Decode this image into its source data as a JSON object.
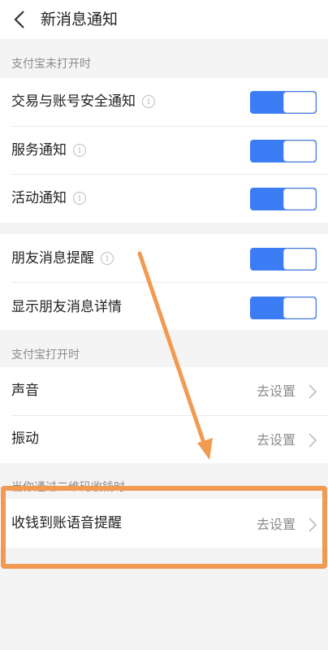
{
  "header": {
    "title": "新消息通知",
    "back_icon": "chevron-left-icon"
  },
  "section1": {
    "label": "支付宝未打开时"
  },
  "rows1": [
    {
      "label": "交易与账号安全通知",
      "info": true,
      "toggle_on": true
    },
    {
      "label": "服务通知",
      "info": true,
      "toggle_on": true
    },
    {
      "label": "活动通知",
      "info": true,
      "toggle_on": true
    }
  ],
  "rows2": [
    {
      "label": "朋友消息提醒",
      "info": true,
      "toggle_on": true
    },
    {
      "label": "显示朋友消息详情",
      "info": false,
      "toggle_on": true
    }
  ],
  "section2": {
    "label": "支付宝打开时"
  },
  "rows3": [
    {
      "label": "声音",
      "value": "去设置"
    },
    {
      "label": "振动",
      "value": "去设置"
    }
  ],
  "section3": {
    "label": "当你通过二维码收钱时"
  },
  "rows4": [
    {
      "label": "收钱到账语音提醒",
      "value": "去设置"
    }
  ],
  "info_glyph": "i",
  "colors": {
    "toggle_on": "#3c7cf5",
    "annotation": "#f19a52",
    "background": "#f4f4f4"
  }
}
